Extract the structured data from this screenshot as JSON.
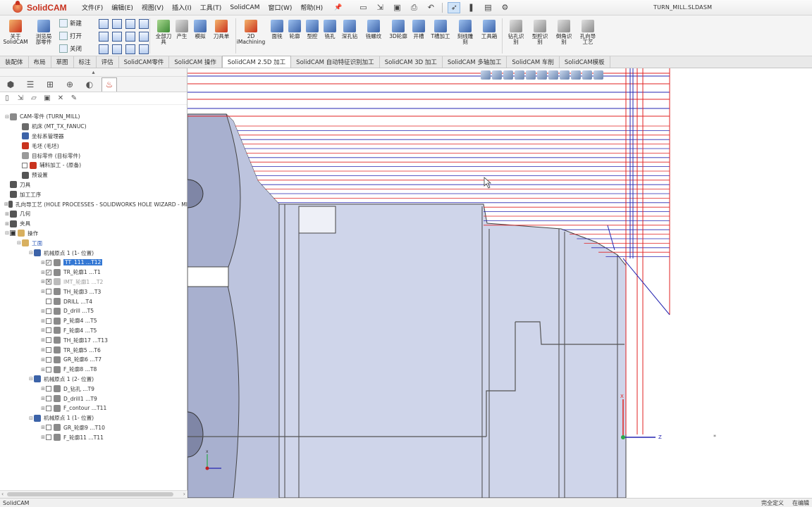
{
  "app": {
    "logo_text": "SolidCAM",
    "document_title": "TURN_MILL.SLDASM"
  },
  "menu": [
    "文件(F)",
    "编辑(E)",
    "视图(V)",
    "插入(I)",
    "工具(T)",
    "SolidCAM",
    "窗口(W)",
    "帮助(H)"
  ],
  "quick_icons": [
    "new-doc-icon",
    "open-icon",
    "save-icon",
    "print-icon",
    "undo-icon",
    "select-arrow-icon",
    "traffic-light-icon",
    "options-icon",
    "gear-icon"
  ],
  "ribbon": {
    "about": "关于\nSolidCAM",
    "browse": "浏览局\n部零件",
    "new": "新建",
    "open": "打开",
    "close": "关闭",
    "full_tool": "全部刀\n具",
    "gcode": "产生",
    "sim": "模拟",
    "tool_list": "刀具单",
    "imachining": "2D\niMachining",
    "ops": [
      "面铣",
      "轮廓",
      "型腔",
      "铣孔",
      "深孔钻",
      "铣螺纹",
      "3D轮廓",
      "开槽",
      "T槽加工",
      "刻线雕\n刻",
      "工具箱"
    ],
    "recog": [
      "钻孔识\n别",
      "型腔识\n别",
      "倒角识\n别",
      "孔向导\n工艺"
    ]
  },
  "tabs": [
    "装配体",
    "布局",
    "草图",
    "标注",
    "评估",
    "SolidCAM零件",
    "SolidCAM 操作",
    "SolidCAM 2.5D 加工",
    "SolidCAM 自动特征识别加工",
    "SolidCAM 3D 加工",
    "SolidCAM 多轴加工",
    "SolidCAM 车削",
    "SolidCAM模板"
  ],
  "active_tab": "SolidCAM 2.5D 加工",
  "panel_tabs": [
    "cam-manager-icon",
    "property-icon",
    "config-icon",
    "target-icon",
    "appearance-icon",
    "solidcam-icon"
  ],
  "panel_tools": [
    "new-icon",
    "open-icon",
    "folder-icon",
    "save-icon",
    "delete-icon",
    "tool-icon"
  ],
  "tree": [
    {
      "depth": 0,
      "exp": "⊟",
      "icon": "cam-part-icon",
      "color": "#8a8a8a",
      "label": "CAM-零件 (TURN_MILL)"
    },
    {
      "depth": 1,
      "icon": "machine-icon",
      "color": "#6b6b6b",
      "label": "机床 (MT_TX_FANUC)"
    },
    {
      "depth": 1,
      "icon": "coordinate-icon",
      "color": "#3c63a8",
      "label": "坐标系管理器"
    },
    {
      "depth": 1,
      "icon": "stock-icon",
      "color": "#c9331e",
      "label": "毛坯 (毛坯)"
    },
    {
      "depth": 1,
      "icon": "target-part-icon",
      "color": "#9a9a9a",
      "label": "目标零件 (目标零件)"
    },
    {
      "depth": 1,
      "cb": " ",
      "icon": "fixture-icon",
      "color": "#c9331e",
      "label": "辅料加工 - (原备)"
    },
    {
      "depth": 1,
      "icon": "settings-icon",
      "color": "#555",
      "label": "预设置"
    },
    {
      "depth": 0,
      "icon": "tool-icon",
      "color": "#555",
      "label": "刀具"
    },
    {
      "depth": 0,
      "icon": "process-icon",
      "color": "#555",
      "label": "加工工序"
    },
    {
      "depth": 0,
      "exp": "⊞",
      "icon": "hole-wizard-icon",
      "color": "#555",
      "label": "孔向导工艺 (HOLE PROCESSES - SOLIDWORKS HOLE WIZARD - MI"
    },
    {
      "depth": 0,
      "exp": "⊞",
      "icon": "geometry-icon",
      "color": "#555",
      "label": "几何"
    },
    {
      "depth": 0,
      "exp": "⊞",
      "icon": "fixture-icon",
      "color": "#555",
      "label": "夹具"
    },
    {
      "depth": 0,
      "exp": "⊟",
      "cb": "■",
      "icon": "folder-icon",
      "color": "#d8b060",
      "label": "操作"
    },
    {
      "depth": 1,
      "exp": "⊟",
      "icon": "folder-icon",
      "color": "#d8b060",
      "label": "工面",
      "blue": true
    },
    {
      "depth": 2,
      "exp": "⊟",
      "icon": "mac-origin-icon",
      "color": "#3c63a8",
      "label": "机械原点 1 (1- 位置)"
    },
    {
      "depth": 3,
      "exp": "⊞",
      "cb": "✓",
      "icon": "turn-op-icon",
      "color": "#8a8a8a",
      "label": "TT_111 ...T12",
      "hl": true
    },
    {
      "depth": 3,
      "exp": "⊞",
      "cb": "✓",
      "icon": "turn-op-icon",
      "color": "#8a8a8a",
      "label": "TR_轮廓1 ...T1"
    },
    {
      "depth": 3,
      "exp": "⊞",
      "cb": "✕",
      "icon": "turn-op-icon",
      "color": "#bbbbbb",
      "label": "IMT_轮廓1 ...T2",
      "dim": true
    },
    {
      "depth": 3,
      "exp": "⊞",
      "cb": " ",
      "icon": "turn-op-icon",
      "color": "#8a8a8a",
      "label": "TH_轮廓3 ...T3"
    },
    {
      "depth": 3,
      "cb": " ",
      "icon": "drill-op-icon",
      "color": "#8a8a8a",
      "label": "DRILL ...T4"
    },
    {
      "depth": 3,
      "exp": "⊞",
      "cb": " ",
      "icon": "drill-op-icon",
      "color": "#8a8a8a",
      "label": "D_drill ...T5"
    },
    {
      "depth": 3,
      "exp": "⊞",
      "cb": " ",
      "icon": "mill-op-icon",
      "color": "#8a8a8a",
      "label": "P_轮廓4 ...T5"
    },
    {
      "depth": 3,
      "exp": "⊞",
      "cb": " ",
      "icon": "mill-op-icon",
      "color": "#8a8a8a",
      "label": "F_轮廓4 ...T5"
    },
    {
      "depth": 3,
      "exp": "⊞",
      "cb": " ",
      "icon": "turn-op-icon",
      "color": "#8a8a8a",
      "label": "TH_轮廓17 ...T13"
    },
    {
      "depth": 3,
      "exp": "⊞",
      "cb": " ",
      "icon": "turn-op-icon",
      "color": "#8a8a8a",
      "label": "TR_轮廓5 ...T6"
    },
    {
      "depth": 3,
      "exp": "⊞",
      "cb": " ",
      "icon": "groove-op-icon",
      "color": "#8a8a8a",
      "label": "GR_轮廓6 ...T7"
    },
    {
      "depth": 3,
      "exp": "⊞",
      "cb": " ",
      "icon": "mill-op-icon",
      "color": "#8a8a8a",
      "label": "F_轮廓8 ...T8"
    },
    {
      "depth": 2,
      "exp": "⊟",
      "icon": "mac-origin-icon",
      "color": "#3c63a8",
      "label": "机械原点 1 (2- 位置)"
    },
    {
      "depth": 3,
      "exp": "⊞",
      "cb": " ",
      "icon": "drill-op-icon",
      "color": "#8a8a8a",
      "label": "D_钻孔 ...T9"
    },
    {
      "depth": 3,
      "exp": "⊞",
      "cb": " ",
      "icon": "drill-op-icon",
      "color": "#8a8a8a",
      "label": "D_drill1 ...T9"
    },
    {
      "depth": 3,
      "exp": "⊞",
      "cb": " ",
      "icon": "mill-op-icon",
      "color": "#8a8a8a",
      "label": "F_contour ...T11"
    },
    {
      "depth": 2,
      "exp": "⊟",
      "icon": "mac-origin-icon",
      "color": "#3c63a8",
      "label": "机械原点 1 (1- 位置)"
    },
    {
      "depth": 3,
      "exp": "⊞",
      "cb": " ",
      "icon": "groove-op-icon",
      "color": "#8a8a8a",
      "label": "GR_轮廓9 ...T10"
    },
    {
      "depth": 3,
      "exp": "⊞",
      "cb": " ",
      "icon": "mill-op-icon",
      "color": "#8a8a8a",
      "label": "F_轮廓11 ...T11"
    }
  ],
  "viewport": {
    "axis_z_label": "Z",
    "axis_x_label": "X",
    "small_axis_x_label": "x",
    "colors": {
      "toolpath_red": "#e02020",
      "toolpath_blue": "#2424b0",
      "part_fill": "#cfd5ea",
      "part_dark": "#a8b0cf"
    }
  },
  "status": {
    "left": "SolidCAM",
    "right1": "完全定义",
    "right2": "在编辑"
  }
}
